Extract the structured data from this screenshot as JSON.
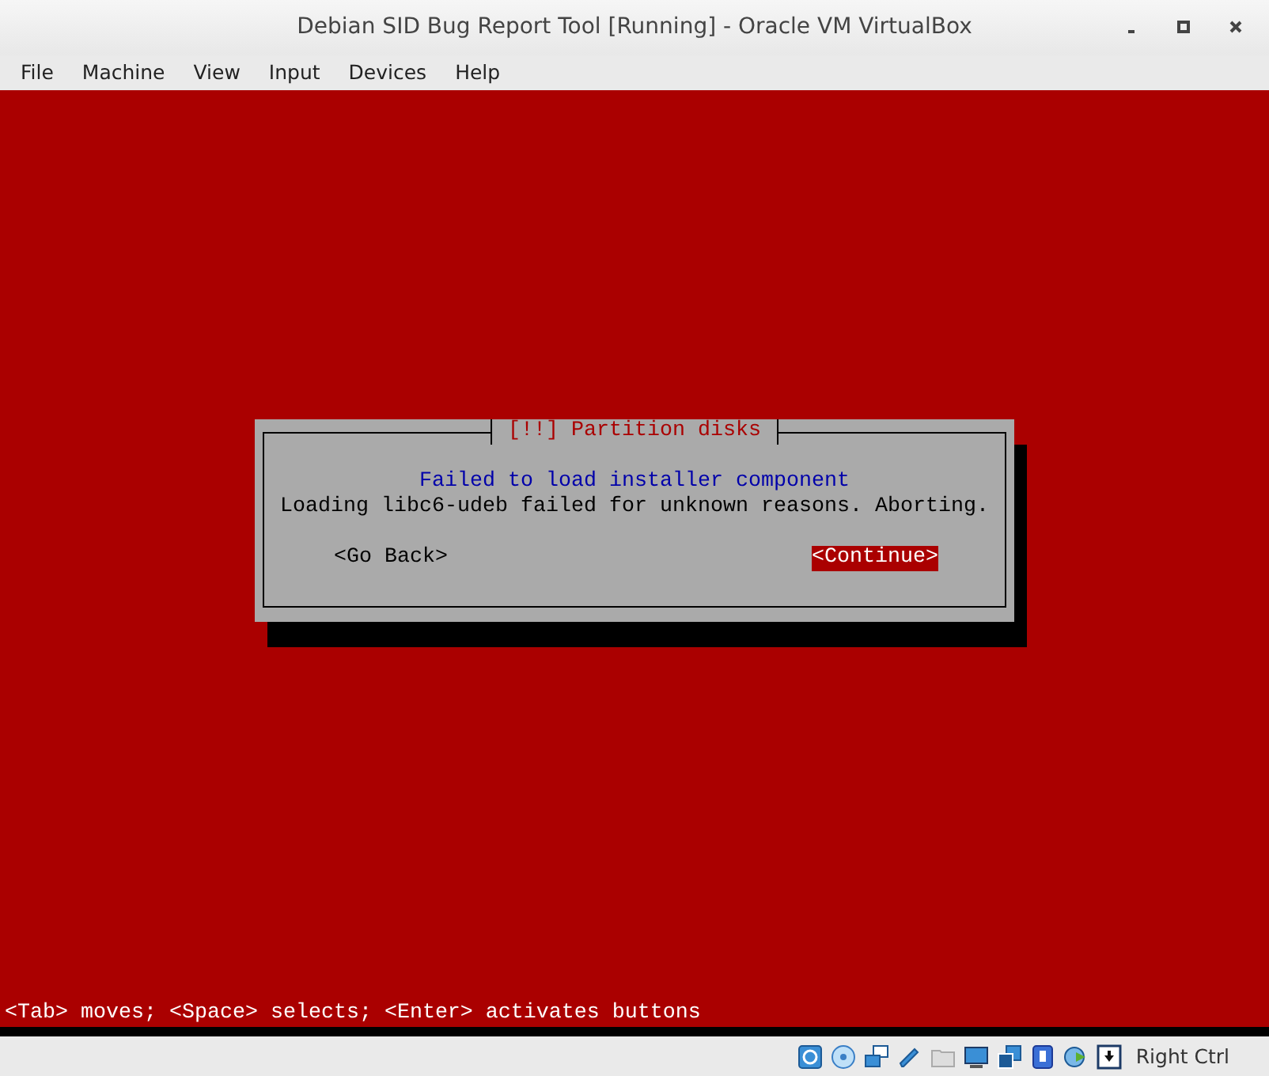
{
  "window": {
    "title": "Debian SID Bug Report Tool [Running] - Oracle VM VirtualBox"
  },
  "menu": [
    "File",
    "Machine",
    "View",
    "Input",
    "Devices",
    "Help"
  ],
  "dialog": {
    "title": "[!!] Partition disks",
    "heading": "Failed to load installer component",
    "message": "Loading libc6-udeb failed for unknown reasons. Aborting.",
    "buttons": [
      {
        "label": "<Go Back>",
        "selected": false
      },
      {
        "label": "<Continue>",
        "selected": true
      }
    ]
  },
  "hint": "<Tab> moves; <Space> selects; <Enter> activates buttons",
  "status_bar": {
    "host_key": "Right Ctrl"
  }
}
